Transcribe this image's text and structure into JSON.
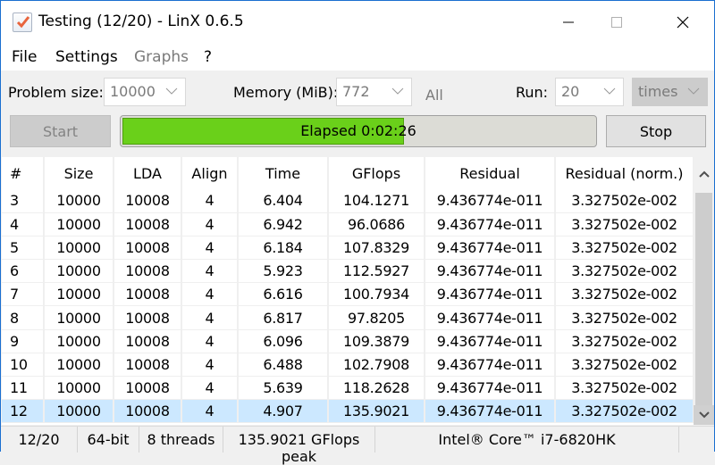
{
  "window": {
    "title": "Testing (12/20) - LinX 0.6.5",
    "icon": "checkbox-app-icon",
    "controls": {
      "minimize": "minimize-icon",
      "maximize": "maximize-icon",
      "close": "close-icon"
    }
  },
  "menu": {
    "items": [
      {
        "label": "File",
        "enabled": true
      },
      {
        "label": "Settings",
        "enabled": true
      },
      {
        "label": "Graphs",
        "enabled": false
      },
      {
        "label": "?",
        "enabled": true
      }
    ]
  },
  "settings": {
    "problem_size_label": "Problem size:",
    "problem_size_value": "10000",
    "memory_label": "Memory (MiB):",
    "memory_value": "772",
    "all_label": "All",
    "run_label": "Run:",
    "run_value": "20",
    "run_unit": "times"
  },
  "actions": {
    "start_label": "Start",
    "stop_label": "Stop"
  },
  "progress": {
    "text": "Elapsed 0:02:26",
    "percent": 60
  },
  "table": {
    "columns": [
      "#",
      "Size",
      "LDA",
      "Align",
      "Time",
      "GFlops",
      "Residual",
      "Residual (norm.)"
    ],
    "rows": [
      [
        "3",
        "10000",
        "10008",
        "4",
        "6.404",
        "104.1271",
        "9.436774e-011",
        "3.327502e-002"
      ],
      [
        "4",
        "10000",
        "10008",
        "4",
        "6.942",
        "96.0686",
        "9.436774e-011",
        "3.327502e-002"
      ],
      [
        "5",
        "10000",
        "10008",
        "4",
        "6.184",
        "107.8329",
        "9.436774e-011",
        "3.327502e-002"
      ],
      [
        "6",
        "10000",
        "10008",
        "4",
        "5.923",
        "112.5927",
        "9.436774e-011",
        "3.327502e-002"
      ],
      [
        "7",
        "10000",
        "10008",
        "4",
        "6.616",
        "100.7934",
        "9.436774e-011",
        "3.327502e-002"
      ],
      [
        "8",
        "10000",
        "10008",
        "4",
        "6.817",
        "97.8205",
        "9.436774e-011",
        "3.327502e-002"
      ],
      [
        "9",
        "10000",
        "10008",
        "4",
        "6.096",
        "109.3879",
        "9.436774e-011",
        "3.327502e-002"
      ],
      [
        "10",
        "10000",
        "10008",
        "4",
        "6.488",
        "102.7908",
        "9.436774e-011",
        "3.327502e-002"
      ],
      [
        "11",
        "10000",
        "10008",
        "4",
        "5.639",
        "118.2628",
        "9.436774e-011",
        "3.327502e-002"
      ],
      [
        "12",
        "10000",
        "10008",
        "4",
        "4.907",
        "135.9021",
        "9.436774e-011",
        "3.327502e-002"
      ]
    ],
    "selected_row": "12"
  },
  "status": {
    "progress": "12/20",
    "arch": "64-bit",
    "threads": "8 threads",
    "peak": "135.9021 GFlops peak",
    "cpu": "Intel® Core™ i7-6820HK"
  },
  "colors": {
    "progress_fill": "#6ad01a",
    "selection": "#cce8ff",
    "window_border": "#1a6fd0"
  }
}
